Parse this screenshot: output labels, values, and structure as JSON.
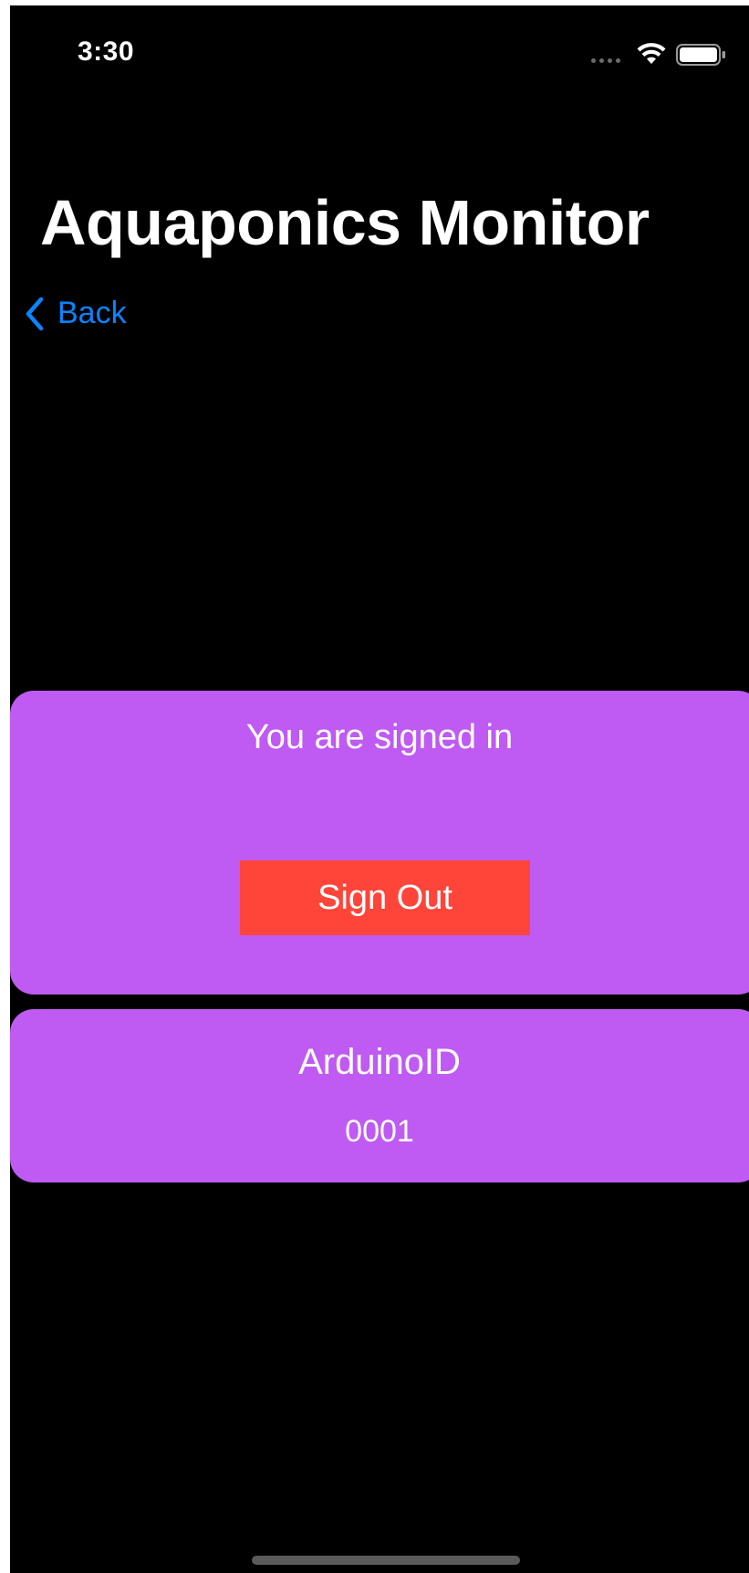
{
  "status_bar": {
    "time": "3:30"
  },
  "navigation": {
    "title": "Aquaponics Monitor",
    "back_label": "Back"
  },
  "signin_card": {
    "message": "You are signed in",
    "sign_out_label": "Sign Out"
  },
  "arduino_card": {
    "label": "ArduinoID",
    "value": "0001"
  },
  "icons": {
    "wifi": "wifi-icon",
    "battery": "battery-icon",
    "back": "chevron-left-icon"
  },
  "colors": {
    "background": "#000000",
    "card": "#bf5af2",
    "sign_out_button": "#ff453a",
    "link": "#0a84ff",
    "text": "#ffffff"
  }
}
